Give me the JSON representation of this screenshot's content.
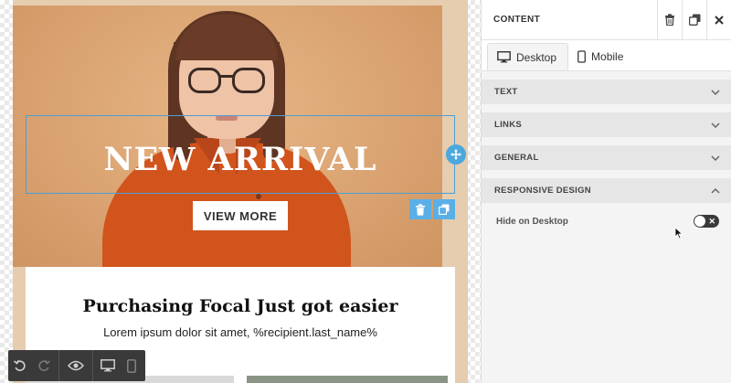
{
  "canvas": {
    "hero": {
      "title": "NEW ARRIVAL",
      "button_label": "VIEW MORE"
    },
    "block_actions": {
      "delete_icon": "trash-icon",
      "duplicate_icon": "copy-icon",
      "move_icon": "move-icon"
    },
    "text_section": {
      "heading": "Purchasing Focal Just got easier",
      "body": "Lorem ipsum dolor sit amet, %recipient.last_name%"
    }
  },
  "bottom_toolbar": {
    "buttons": [
      "undo-icon",
      "redo-icon",
      "preview-eye-icon",
      "desktop-icon",
      "mobile-icon"
    ]
  },
  "panel": {
    "title": "CONTENT",
    "header_icons": [
      "trash-icon",
      "copy-icon",
      "close-icon"
    ],
    "tabs": [
      {
        "label": "Desktop",
        "icon": "desktop-icon",
        "active": true
      },
      {
        "label": "Mobile",
        "icon": "mobile-icon",
        "active": false
      }
    ],
    "sections": [
      {
        "label": "TEXT",
        "expanded": false
      },
      {
        "label": "LINKS",
        "expanded": false
      },
      {
        "label": "GENERAL",
        "expanded": false
      },
      {
        "label": "RESPONSIVE DESIGN",
        "expanded": true
      }
    ],
    "responsive": {
      "hide_on_desktop_label": "Hide on Desktop",
      "hide_on_desktop_value": false
    }
  },
  "colors": {
    "accent": "#4aa8de",
    "hero_bg": "#d9a270",
    "shirt": "#d1541d",
    "toolbar_bg": "#3a3a3a"
  }
}
